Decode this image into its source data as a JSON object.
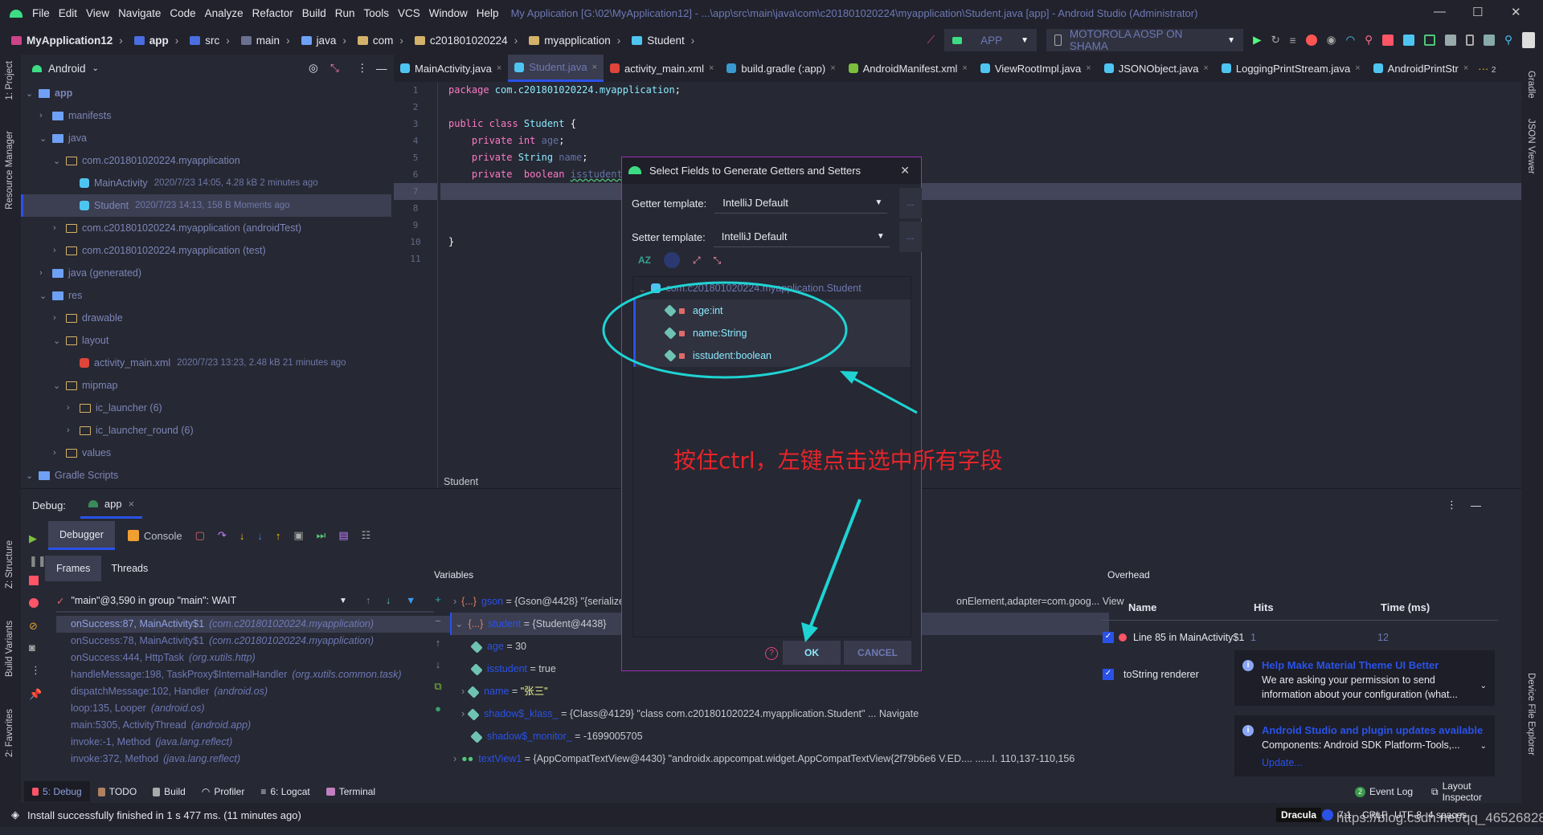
{
  "window": {
    "menu": [
      "File",
      "Edit",
      "View",
      "Navigate",
      "Code",
      "Analyze",
      "Refactor",
      "Build",
      "Run",
      "Tools",
      "VCS",
      "Window",
      "Help"
    ],
    "title": "My Application [G:\\02\\MyApplication12] - ...\\app\\src\\main\\java\\com\\c201801020224\\myapplication\\Student.java [app] - Android Studio (Administrator)"
  },
  "breadcrumb": [
    "MyApplication12",
    "app",
    "src",
    "main",
    "java",
    "com",
    "c201801020224",
    "myapplication",
    "Student"
  ],
  "run": {
    "config": "APP",
    "device": "MOTOROLA AOSP ON SHAMA"
  },
  "project": {
    "view": "Android",
    "tree": [
      {
        "label": "app",
        "depth": 0,
        "open": true
      },
      {
        "label": "manifests",
        "depth": 1,
        "open": false
      },
      {
        "label": "java",
        "depth": 1,
        "open": true
      },
      {
        "label": "com.c201801020224.myapplication",
        "depth": 2,
        "open": true
      },
      {
        "label": "MainActivity",
        "meta": "2020/7/23 14:05, 4.28 kB  2 minutes ago",
        "depth": 3,
        "file": "class"
      },
      {
        "label": "Student",
        "meta": "2020/7/23 14:13, 158 B  Moments ago",
        "depth": 3,
        "file": "class",
        "selected": true
      },
      {
        "label": "com.c201801020224.myapplication (androidTest)",
        "depth": 2,
        "open": false
      },
      {
        "label": "com.c201801020224.myapplication (test)",
        "depth": 2,
        "open": false
      },
      {
        "label": "java (generated)",
        "depth": 1,
        "open": false
      },
      {
        "label": "res",
        "depth": 1,
        "open": true
      },
      {
        "label": "drawable",
        "depth": 2,
        "open": false
      },
      {
        "label": "layout",
        "depth": 2,
        "open": true
      },
      {
        "label": "activity_main.xml",
        "meta": "2020/7/23 13:23, 2.48 kB  21 minutes ago",
        "depth": 3,
        "file": "xml"
      },
      {
        "label": "mipmap",
        "depth": 2,
        "open": true
      },
      {
        "label": "ic_launcher (6)",
        "depth": 3,
        "open": false
      },
      {
        "label": "ic_launcher_round (6)",
        "depth": 3,
        "open": false
      },
      {
        "label": "values",
        "depth": 2,
        "open": false
      },
      {
        "label": "Gradle Scripts",
        "depth": 0,
        "open": true
      }
    ]
  },
  "tabs": [
    "MainActivity.java",
    "Student.java",
    "activity_main.xml",
    "build.gradle (:app)",
    "AndroidManifest.xml",
    "ViewRootImpl.java",
    "JSONObject.java",
    "LoggingPrintStream.java",
    "AndroidPrintStr"
  ],
  "tabs_more": "2",
  "code": {
    "lines": [
      [
        [
          "kw",
          "package "
        ],
        [
          "ty",
          "com.c201801020224.myapplication"
        ],
        [
          "pl",
          ";"
        ]
      ],
      [],
      [
        [
          "kw",
          "public class "
        ],
        [
          "ty",
          "Student "
        ],
        [
          "pl",
          "{"
        ]
      ],
      [
        [
          "kw",
          "    private "
        ],
        [
          "kw",
          "int "
        ],
        [
          "fd",
          "age"
        ],
        [
          "pl",
          ";"
        ]
      ],
      [
        [
          "kw",
          "    private "
        ],
        [
          "ty",
          "String "
        ],
        [
          "fd",
          "name"
        ],
        [
          "pl",
          ";"
        ]
      ],
      [
        [
          "kw",
          "    private  boolean "
        ],
        [
          "fd",
          "isstudent"
        ],
        [
          "pl",
          ";"
        ]
      ],
      [],
      [],
      [],
      [
        [
          "pl",
          "}"
        ]
      ],
      []
    ],
    "breadcrumb": "Student"
  },
  "side": {
    "left": [
      "1: Project",
      "Resource Manager",
      "Z: Structure",
      "Build Variants",
      "2: Favorites"
    ],
    "right": [
      "Gradle",
      "JSON Viewer",
      "Device File Explorer"
    ]
  },
  "debug": {
    "label": "Debug:",
    "session": "app",
    "tabs": [
      "Debugger",
      "Console"
    ],
    "subtabs": [
      "Frames",
      "Threads"
    ],
    "thread": "\"main\"@3,590 in group \"main\": WAIT",
    "frames": [
      [
        "onSuccess:87, MainActivity$1",
        "(com.c201801020224.myapplication)"
      ],
      [
        "onSuccess:78, MainActivity$1",
        "(com.c201801020224.myapplication)"
      ],
      [
        "onSuccess:444, HttpTask",
        "(org.xutils.http)"
      ],
      [
        "handleMessage:198, TaskProxy$InternalHandler",
        "(org.xutils.common.task)"
      ],
      [
        "dispatchMessage:102, Handler",
        "(android.os)"
      ],
      [
        "loop:135, Looper",
        "(android.os)"
      ],
      [
        "main:5305, ActivityThread",
        "(android.app)"
      ],
      [
        "invoke:-1, Method",
        "(java.lang.reflect)"
      ],
      [
        "invoke:372, Method",
        "(java.lang.reflect)"
      ]
    ],
    "variables_title": "Variables",
    "variables": [
      {
        "name": "gson",
        "value": " = {Gson@4428} \"{serialize",
        "tail": "onElement,adapter=com.goog... View",
        "depth": 0
      },
      {
        "name": "student",
        "value": " = {Student@4438}",
        "depth": 0,
        "selected": true
      },
      {
        "name": "age",
        "value": " = 30",
        "depth": 1
      },
      {
        "name": "isstudent",
        "value": " = true",
        "depth": 1
      },
      {
        "name": "name",
        "value": " = ",
        "str": "\"张三\"",
        "depth": 1
      },
      {
        "name": "shadow$_klass_",
        "value": " = {Class@4129} \"class com.c201801020224.myapplication.Student\" ... Navigate",
        "depth": 1
      },
      {
        "name": "shadow$_monitor_",
        "value": " = -1699005705",
        "depth": 1
      },
      {
        "name": "textView1",
        "value": " = {AppCompatTextView@4430} \"androidx.appcompat.widget.AppCompatTextView{2f79b6e6 V.ED.... ......I. 110,137-110,156",
        "depth": 0
      }
    ],
    "overhead": {
      "title": "Overhead",
      "cols": [
        "Name",
        "Hits",
        "Time (ms)"
      ],
      "rows": [
        {
          "name": "Line 85 in MainActivity$1",
          "hits": "1",
          "time": "12"
        },
        {
          "name": "toString renderer",
          "hits": "",
          "time": ""
        }
      ]
    }
  },
  "notifications": [
    {
      "title": "Help Make Material Theme UI Better",
      "body": "We are asking your permission to send information about your configuration (what..."
    },
    {
      "title": "Android Studio and plugin updates available",
      "body": "Components: Android SDK Platform-Tools,...",
      "link": "Update..."
    }
  ],
  "bottom_tabs": [
    "5: Debug",
    "TODO",
    "Build",
    "Profiler",
    "6: Logcat",
    "Terminal"
  ],
  "bottom_right": {
    "event_log": "Event Log",
    "event_count": "2",
    "layout_inspector": "Layout Inspector"
  },
  "status": {
    "message": "Install successfully finished in 1 s 477 ms. (11 minutes ago)",
    "theme": "Dracula",
    "position": "7:1",
    "line_sep": "CRLF",
    "encoding": "UTF-8",
    "indent": "4 spaces",
    "watermark": "https://blog.csdn.net/qq_46526828"
  },
  "dialog": {
    "title": "Select Fields to Generate Getters and Setters",
    "getter_label": "Getter template:",
    "getter_value": "IntelliJ Default",
    "setter_label": "Setter template:",
    "setter_value": "IntelliJ Default",
    "class": "com.c201801020224.myapplication.Student",
    "fields": [
      "age:int",
      "name:String",
      "isstudent:boolean"
    ],
    "ok": "OK",
    "cancel": "CANCEL",
    "more": "..."
  },
  "annotation": {
    "text": "按住ctrl，左键点击选中所有字段",
    "color": "#e8242a",
    "mark_color": "#1fd3d3"
  },
  "colors": {
    "accent": "#2a52e8",
    "bg": "#262833"
  }
}
